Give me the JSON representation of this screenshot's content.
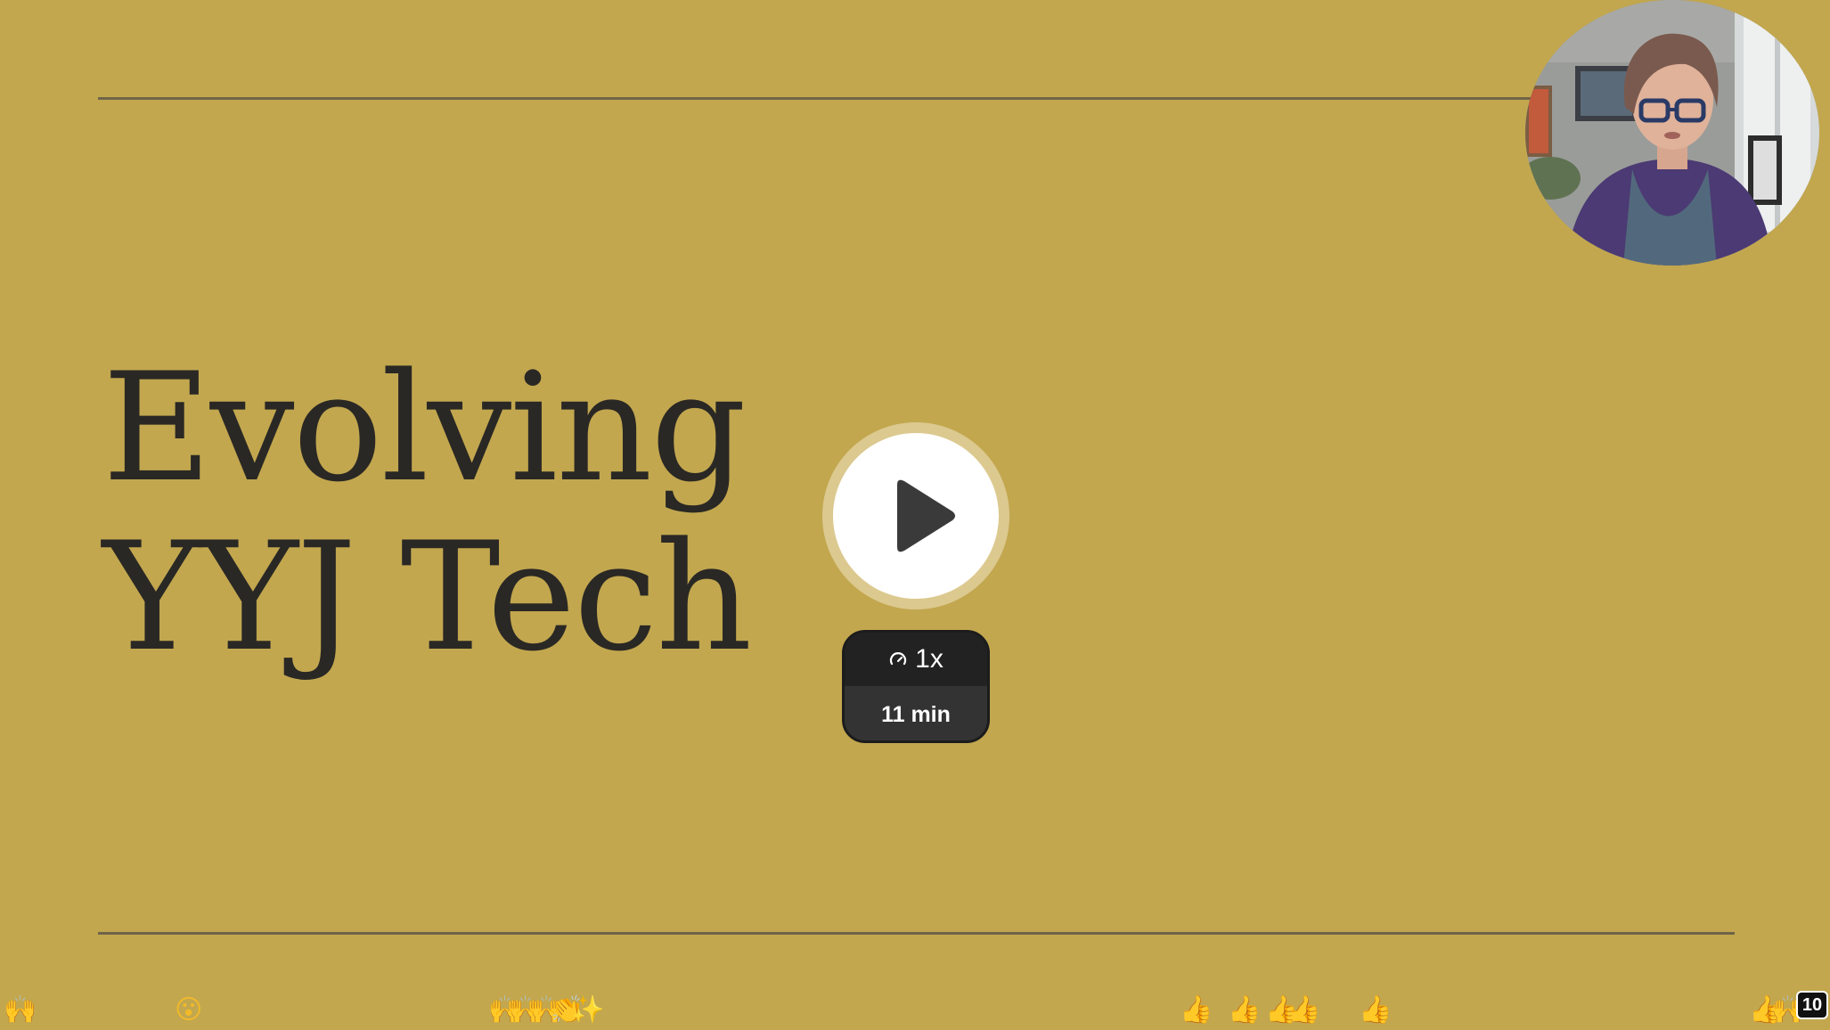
{
  "slide": {
    "title_line1": "Evolving",
    "title_line2": "YYJ Tech"
  },
  "player": {
    "speed_label": "1x",
    "duration_label": "11 min",
    "reactions_count": "10"
  },
  "reactions": [
    {
      "name": "reaction-raised-hands",
      "glyph": "🙌"
    },
    {
      "name": "reaction-surprised",
      "glyph": "😮"
    },
    {
      "name": "reaction-clapping-cluster",
      "glyph": "🙌🙌🙌👏✨"
    },
    {
      "name": "reaction-thumbs-up-1",
      "glyph": "👍"
    },
    {
      "name": "reaction-thumbs-up-2",
      "glyph": "👍"
    },
    {
      "name": "reaction-thumbs-up-3",
      "glyph": "👍👍"
    },
    {
      "name": "reaction-thumbs-up-4",
      "glyph": "👍"
    },
    {
      "name": "reaction-thumbs-up-5",
      "glyph": "👍🙌"
    }
  ],
  "colors": {
    "slide_background": "#c2a74f",
    "title_text": "#2a2824",
    "rule_line": "#6f6448",
    "play_ring": "#dcc98f",
    "pill_background": "#2b2b2b"
  }
}
